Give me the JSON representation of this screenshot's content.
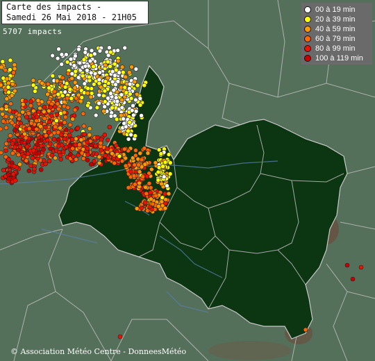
{
  "header": {
    "title_line1": "Carte des impacts -",
    "title_line2": "Samedi 26 Mai 2018 - 21H05"
  },
  "impact_count": "5707 impacts",
  "legend": [
    {
      "label": "00 à 19 min",
      "color": "#ffffff"
    },
    {
      "label": "20 à 39 min",
      "color": "#ffff00"
    },
    {
      "label": "40 à 59 min",
      "color": "#ff9900"
    },
    {
      "label": "60 à 79 min",
      "color": "#ff6600"
    },
    {
      "label": "80 à 99 min",
      "color": "#ee1100"
    },
    {
      "label": "100 à 119 min",
      "color": "#cc0000"
    }
  ],
  "copyright": "© Association Météo Centre - DonneesMétéo",
  "colors": {
    "background": "#55705a",
    "region_fill": "#0c3512",
    "border": "#c9c9c9",
    "river": "#5a7fa6"
  }
}
